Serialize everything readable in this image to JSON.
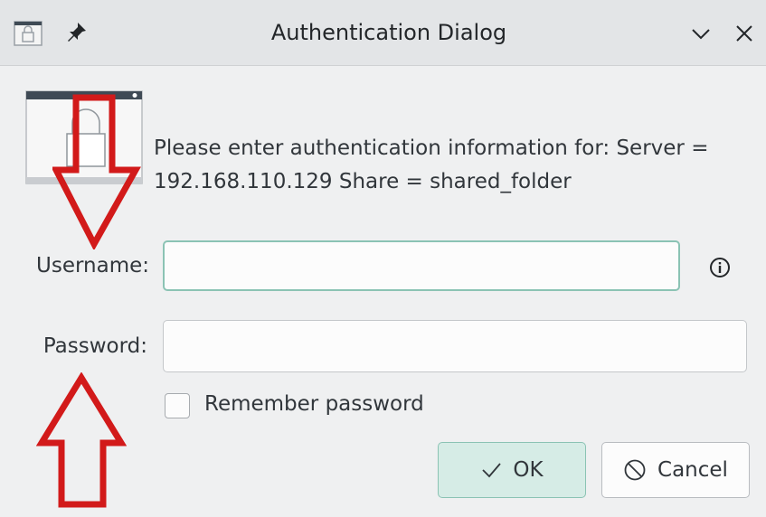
{
  "window": {
    "title": "Authentication Dialog",
    "icons": {
      "app": "lock-app-icon",
      "pin": "pin-icon",
      "minimize": "chevron-down-icon",
      "close": "close-icon"
    }
  },
  "message": {
    "line1": "Please enter authentication information for: Server =",
    "line2": "192.168.110.129 Share = shared_folder"
  },
  "form": {
    "username_label": "Username:",
    "username_value": "",
    "password_label": "Password:",
    "password_value": "",
    "remember_label": "Remember password",
    "remember_checked": false
  },
  "buttons": {
    "ok_label": "OK",
    "cancel_label": "Cancel"
  },
  "colors": {
    "accent": "#8bc3b4",
    "annotation": "#d21a1a"
  }
}
